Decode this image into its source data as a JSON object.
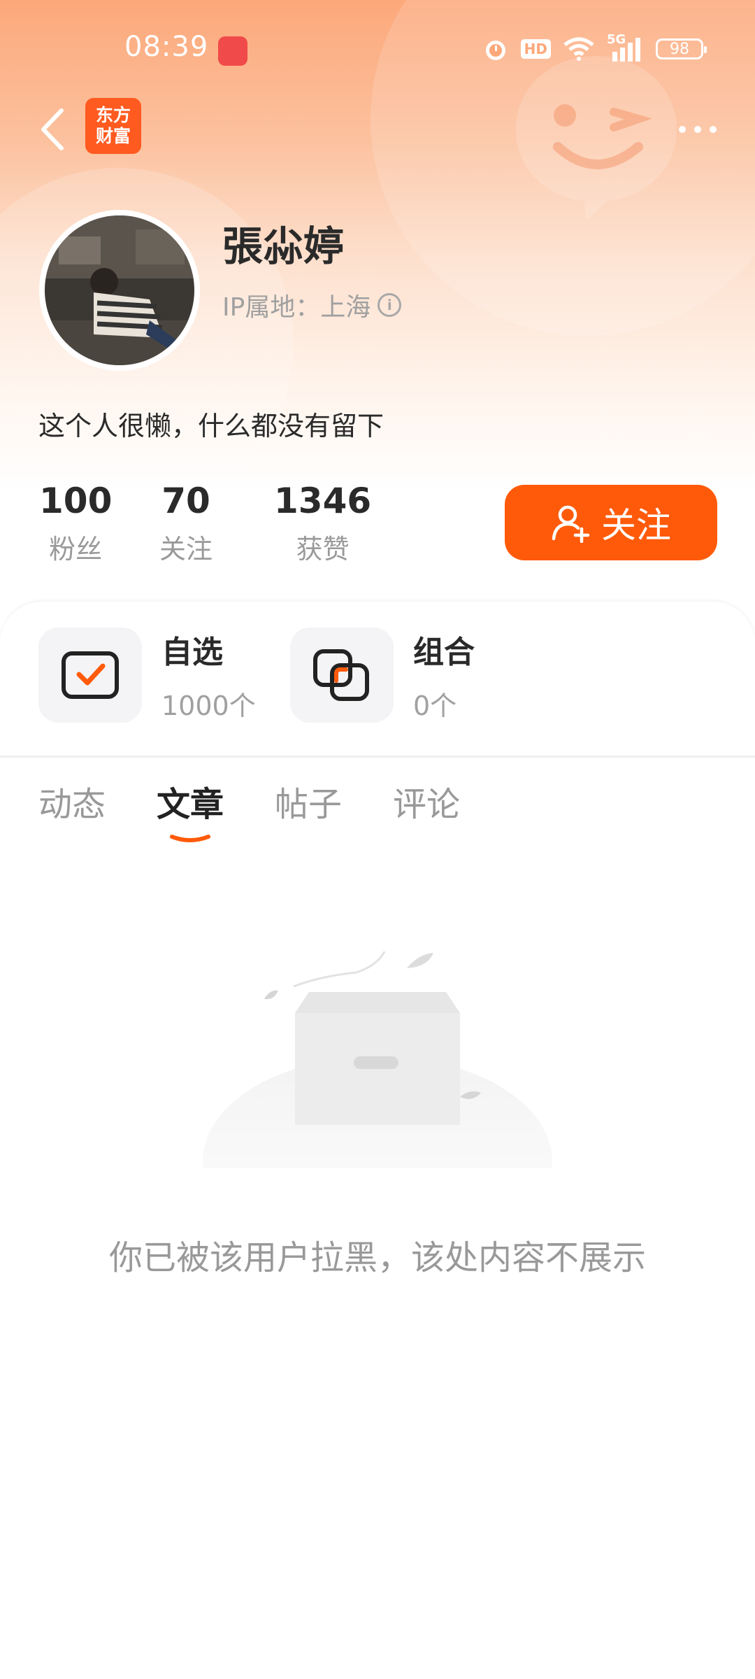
{
  "status_bar": {
    "time": "08:39",
    "battery": "98",
    "network": "5G",
    "hd": "HD"
  },
  "topbar": {
    "brand_line1": "东方",
    "brand_line2": "财富"
  },
  "profile": {
    "name": "張尛婷",
    "ip_location": "IP属地：上海",
    "bio": "这个人很懒，什么都没有留下"
  },
  "stats": [
    {
      "value": "100",
      "label": "粉丝"
    },
    {
      "value": "70",
      "label": "关注"
    },
    {
      "value": "1346",
      "label": "获赞"
    }
  ],
  "follow_button": {
    "label": "关注"
  },
  "features": [
    {
      "title": "自选",
      "count": "1000个"
    },
    {
      "title": "组合",
      "count": "0个"
    }
  ],
  "tabs": [
    {
      "label": "动态",
      "active": false
    },
    {
      "label": "文章",
      "active": true
    },
    {
      "label": "帖子",
      "active": false
    },
    {
      "label": "评论",
      "active": false
    }
  ],
  "empty_state": {
    "message": "你已被该用户拉黑，该处内容不展示"
  },
  "colors": {
    "accent": "#ff5a0a",
    "brand": "#ff5a1f",
    "header_top": "#fca87a"
  }
}
